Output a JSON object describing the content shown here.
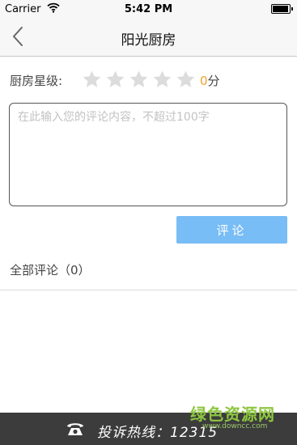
{
  "status_bar": {
    "carrier": "Carrier",
    "time": "5:42 PM",
    "battery_level": 1.0
  },
  "nav": {
    "title": "阳光厨房",
    "back_icon": "chevron-left-icon"
  },
  "rating": {
    "label": "厨房星级:",
    "stars": [
      {
        "icon": "star-icon",
        "filled": false
      },
      {
        "icon": "star-icon",
        "filled": false
      },
      {
        "icon": "star-icon",
        "filled": false
      },
      {
        "icon": "star-icon",
        "filled": false
      },
      {
        "icon": "star-icon",
        "filled": false
      }
    ],
    "score": "0",
    "unit": "分"
  },
  "comment": {
    "placeholder": "在此输入您的评论内容，不超过100字",
    "value": ""
  },
  "submit": {
    "label": "评论"
  },
  "comments": {
    "header": "全部评论（0）"
  },
  "footer": {
    "icon": "phone-icon",
    "hotline": "投诉热线：12315"
  },
  "watermark": {
    "main": "绿色资源网",
    "sub": "www.downcc.com"
  },
  "colors": {
    "accent_button": "#78bdf5",
    "score_number": "#f0a030",
    "star_empty": "#dcdcdc",
    "footer_bg": "#3c3c3c",
    "watermark": "#8dc63f"
  }
}
